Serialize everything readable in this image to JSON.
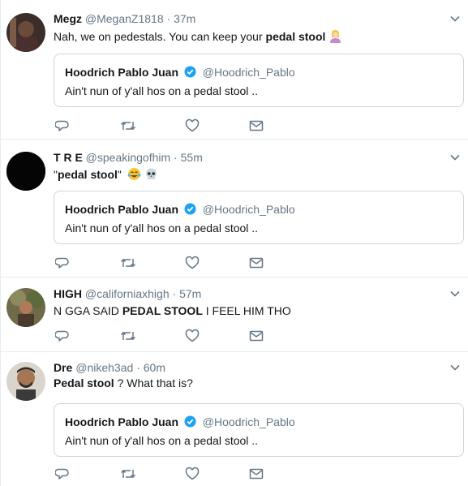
{
  "tweets": [
    {
      "name": "Megz",
      "handle": "@MeganZ1818",
      "dot": "·",
      "time": "37m",
      "text_before": "Nah, we on pedestals. You can keep your ",
      "text_bold": "pedal stool",
      "text_after": "",
      "quote": {
        "name": "Hoodrich Pablo Juan",
        "handle": "@Hoodrich_Pablo",
        "text": "Ain't nun of y'all hos on a pedal stool .."
      }
    },
    {
      "name": "T R E",
      "handle": "@speakingofhim",
      "dot": "·",
      "time": "55m",
      "text_before": "\"",
      "text_bold": "pedal stool",
      "text_after": "\"",
      "quote": {
        "name": "Hoodrich Pablo Juan",
        "handle": "@Hoodrich_Pablo",
        "text": "Ain't nun of y'all hos on a pedal stool .."
      }
    },
    {
      "name": "HIGH",
      "handle": "@californiaxhigh",
      "dot": "·",
      "time": "57m",
      "text_before": "N  GGA SAID ",
      "text_bold": "PEDAL STOOL",
      "text_after": " I FEEL HIM THO"
    },
    {
      "name": "Dre",
      "handle": "@nikeh3ad",
      "dot": "·",
      "time": "60m",
      "text_before": "",
      "text_bold": "Pedal stool",
      "text_after": " ? What that is?",
      "quote": {
        "name": "Hoodrich Pablo Juan",
        "handle": "@Hoodrich_Pablo",
        "text": "Ain't nun of y'all hos on a pedal stool .."
      }
    }
  ],
  "icons": {
    "reply": "reply-icon",
    "retweet": "retweet-icon",
    "like": "like-icon",
    "dm": "direct-message-icon",
    "more": "chevron-down-icon",
    "verified": "verified-badge-icon"
  },
  "colors": {
    "text": "#14171a",
    "muted": "#657786",
    "border": "#e6ecf0",
    "verified": "#1da1f2"
  }
}
